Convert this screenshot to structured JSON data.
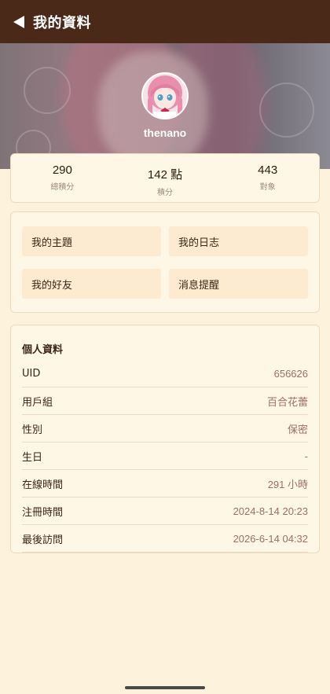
{
  "header": {
    "title": "我的資料",
    "back_icon": "back-arrow-icon"
  },
  "profile": {
    "username": "thenano"
  },
  "stats": [
    {
      "value": "290",
      "label": "總積分"
    },
    {
      "value": "142 點",
      "label": "積分"
    },
    {
      "value": "443",
      "label": "對象"
    }
  ],
  "menu": [
    {
      "label": "我的主題"
    },
    {
      "label": "我的日志"
    },
    {
      "label": "我的好友"
    },
    {
      "label": "消息提醒"
    }
  ],
  "info": {
    "title": "個人資料",
    "rows": [
      {
        "key": "UID",
        "value": "656626"
      },
      {
        "key": "用戶組",
        "value": "百合花蕾"
      },
      {
        "key": "性別",
        "value": "保密"
      },
      {
        "key": "生日",
        "value": "-"
      },
      {
        "key": "在線時間",
        "value": "291 小時"
      },
      {
        "key": "注冊時間",
        "value": "2024-8-14 20:23"
      },
      {
        "key": "最後訪問",
        "value": "2026-6-14 04:32"
      }
    ]
  },
  "colors": {
    "topbar": "#4a2918",
    "background": "#fdf3dc",
    "card": "#fff7e6",
    "menu_button": "#fcebd0",
    "value_text": "#9a6f68"
  }
}
